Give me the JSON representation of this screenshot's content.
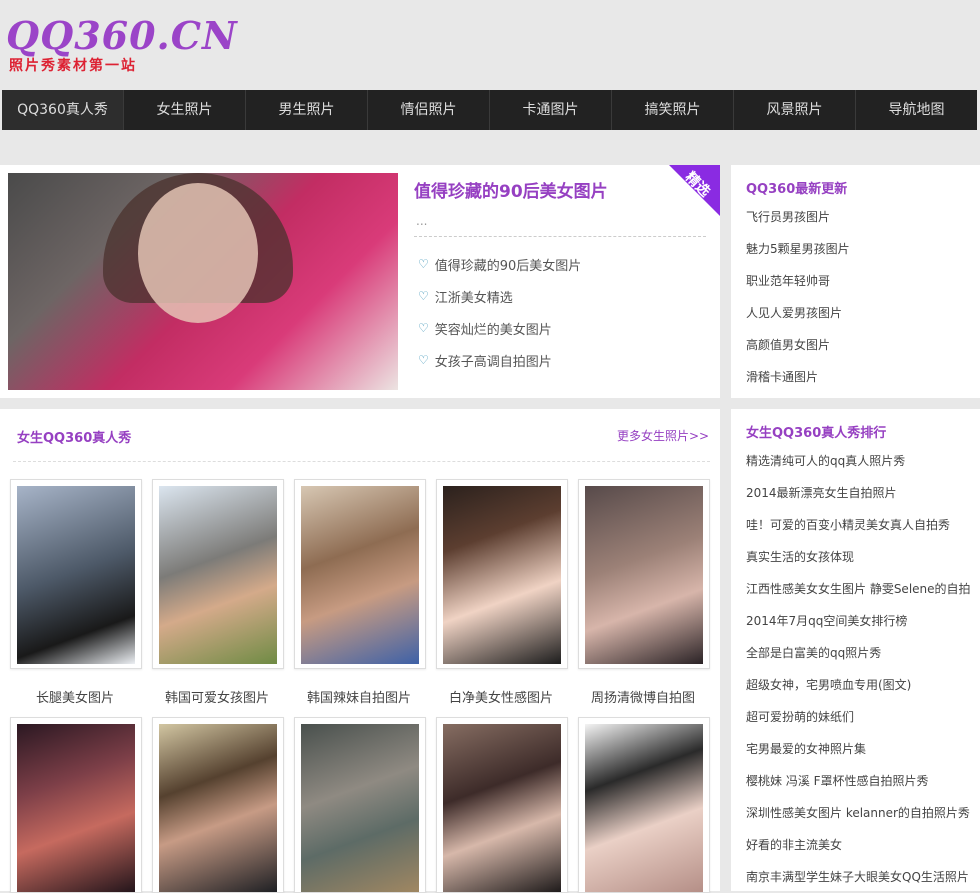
{
  "logo": {
    "main": "QQ360.CN",
    "tagline": "照片秀素材第一站"
  },
  "nav": [
    "QQ360真人秀",
    "女生照片",
    "男生照片",
    "情侣照片",
    "卡通图片",
    "搞笑照片",
    "风景照片",
    "导航地图"
  ],
  "feature": {
    "title": "值得珍藏的90后美女图片",
    "dots": "...",
    "badge": "精选",
    "links": [
      "值得珍藏的90后美女图片",
      "江浙美女精选",
      "笑容灿烂的美女图片",
      "女孩子高调自拍图片"
    ]
  },
  "updates": {
    "title": "QQ360最新更新",
    "items": [
      "飞行员男孩图片",
      "魅力5颗星男孩图片",
      "职业范年轻帅哥",
      "人见人爱男孩图片",
      "高颜值男女图片",
      "滑稽卡通图片"
    ]
  },
  "gallery": {
    "title": "女生QQ360真人秀",
    "more": "更多女生照片>>",
    "row1": [
      "长腿美女图片",
      "韩国可爱女孩图片",
      "韩国辣妹自拍图片",
      "白净美女性感图片",
      "周扬清微博自拍图"
    ]
  },
  "ranking": {
    "title": "女生QQ360真人秀排行",
    "items": [
      "精选清纯可人的qq真人照片秀",
      "2014最新漂亮女生自拍照片",
      "哇！可爱的百变小精灵美女真人自拍秀",
      "真实生活的女孩体现",
      "江西性感美女女生图片 静雯Selene的自拍",
      "2014年7月qq空间美女排行榜",
      "全部是白富美的qq照片秀",
      "超级女神，宅男喷血专用(图文)",
      "超可爱扮萌的妹纸们",
      "宅男最爱的女神照片集",
      "樱桃妹 冯溪 F罩杯性感自拍照片秀",
      "深圳性感美女图片 kelanner的自拍照片秀",
      "好看的非主流美女",
      "南京丰满型学生妹子大眼美女QQ生活照片"
    ]
  }
}
